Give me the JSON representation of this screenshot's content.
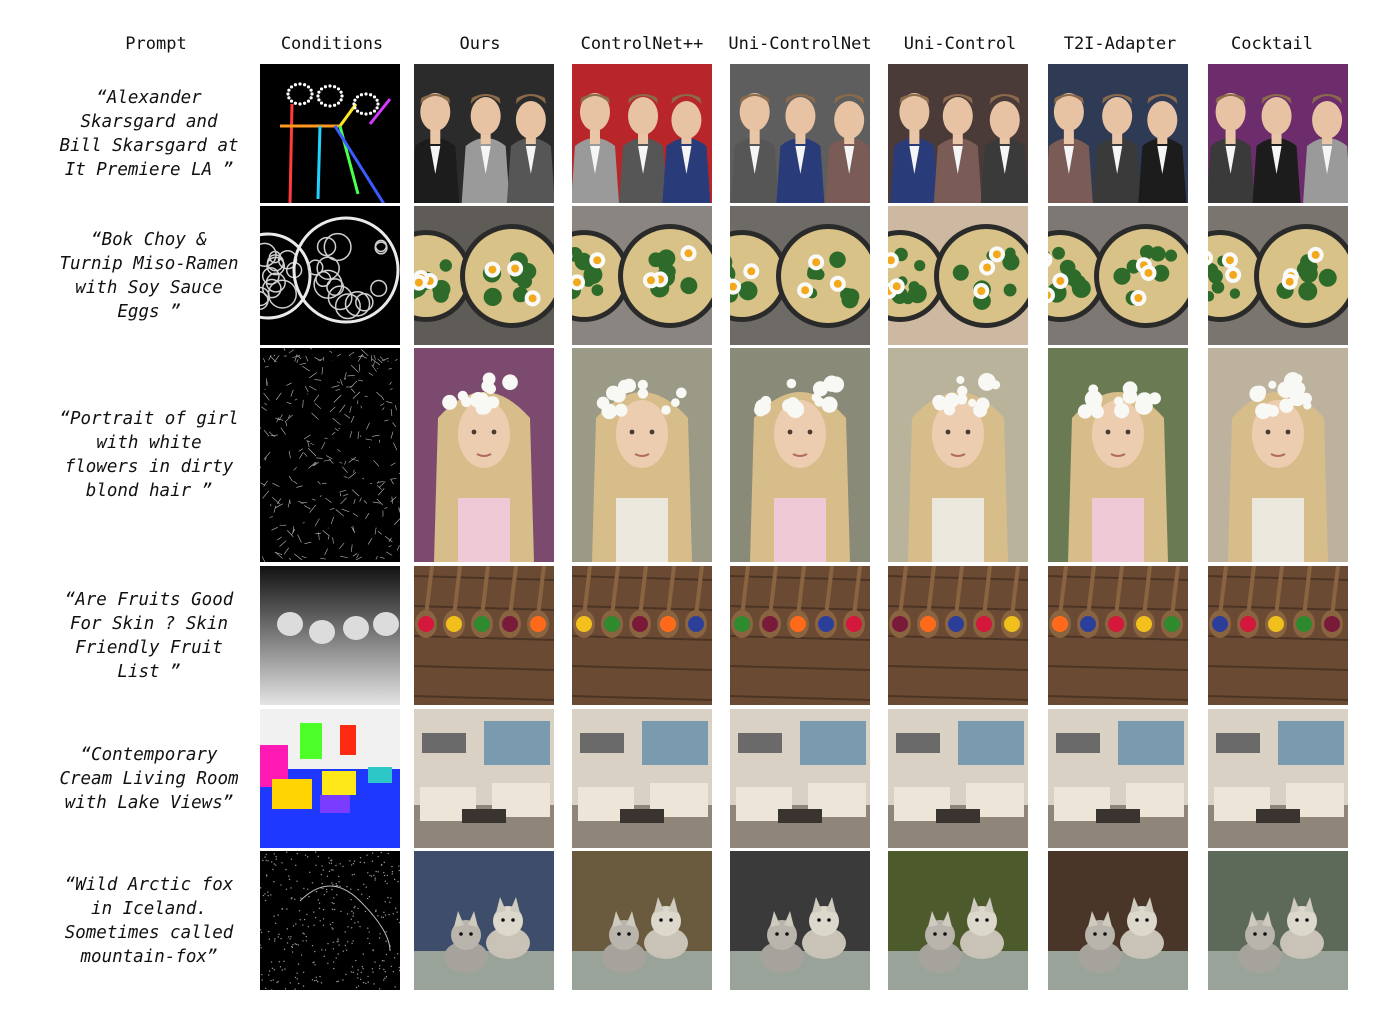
{
  "columns": [
    "Prompt",
    "Conditions",
    "Ours",
    "ControlNet++",
    "Uni-ControlNet",
    "Uni-Control",
    "T2I-Adapter",
    "Cocktail"
  ],
  "rows": [
    {
      "prompt": "“Alexander\nSkarsgard and\nBill Skarsgard at\nIt Premiere LA ”",
      "condition": "pose",
      "scene": "people"
    },
    {
      "prompt": "“Bok Choy &\nTurnip Miso-Ramen\nwith Soy Sauce\nEggs ”",
      "condition": "hed",
      "scene": "ramen"
    },
    {
      "prompt": "“Portrait of girl\nwith white\nflowers in dirty\nblond hair ”",
      "condition": "canny",
      "scene": "girl"
    },
    {
      "prompt": "“Are Fruits Good\nFor Skin ? Skin\nFriendly Fruit\nList ”",
      "condition": "depth",
      "scene": "fruits"
    },
    {
      "prompt": "“Contemporary\nCream Living Room\nwith Lake Views”",
      "condition": "segmentation",
      "scene": "living-room"
    },
    {
      "prompt": "“Wild Arctic fox\nin Iceland.\nSometimes called\nmountain-fox”",
      "condition": "sketch",
      "scene": "fox"
    }
  ],
  "colors": {
    "background": "#ffffff",
    "text": "#111111",
    "condition_bg": "#000000"
  }
}
